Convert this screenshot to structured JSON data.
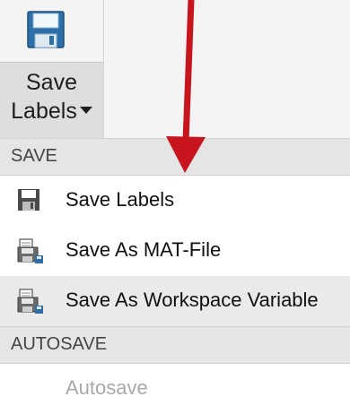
{
  "toolstrip": {
    "save_labels_button": {
      "line1": "Save",
      "line2": "Labels"
    }
  },
  "menu": {
    "save_section": {
      "header": "SAVE",
      "items": [
        {
          "label": "Save Labels",
          "icon": "floppy-disk-icon"
        },
        {
          "label": "Save As MAT-File",
          "icon": "save-as-file-icon"
        },
        {
          "label": "Save As Workspace Variable",
          "icon": "save-as-workspace-icon"
        }
      ]
    },
    "autosave_section": {
      "header": "AUTOSAVE",
      "items": [
        {
          "label": "Autosave",
          "enabled": false
        }
      ]
    }
  },
  "annotation": {
    "arrow_color": "#c8141d"
  }
}
